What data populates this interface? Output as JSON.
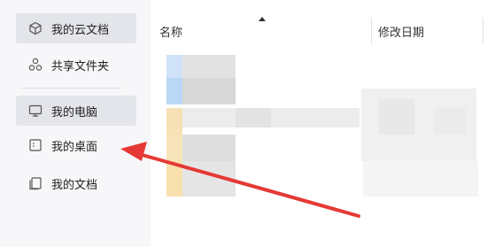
{
  "sidebar": {
    "items": [
      {
        "label": "我的云文档",
        "icon": "cloud-box-icon",
        "state": "active"
      },
      {
        "label": "共享文件夹",
        "icon": "share-nodes-icon",
        "state": "normal"
      },
      {
        "label": "我的电脑",
        "icon": "monitor-icon",
        "state": "hover"
      },
      {
        "label": "我的桌面",
        "icon": "desktop-window-icon",
        "state": "normal"
      },
      {
        "label": "我的文档",
        "icon": "documents-icon",
        "state": "normal"
      }
    ]
  },
  "file_list": {
    "columns": {
      "name": "名称",
      "modified": "修改日期"
    },
    "sort_indicator": "sort-ascending-icon"
  },
  "annotation": {
    "arrow_color": "#e53935"
  },
  "colors": {
    "sidebar_bg": "#f7f7f9",
    "item_active_bg": "#e3e5ea"
  }
}
